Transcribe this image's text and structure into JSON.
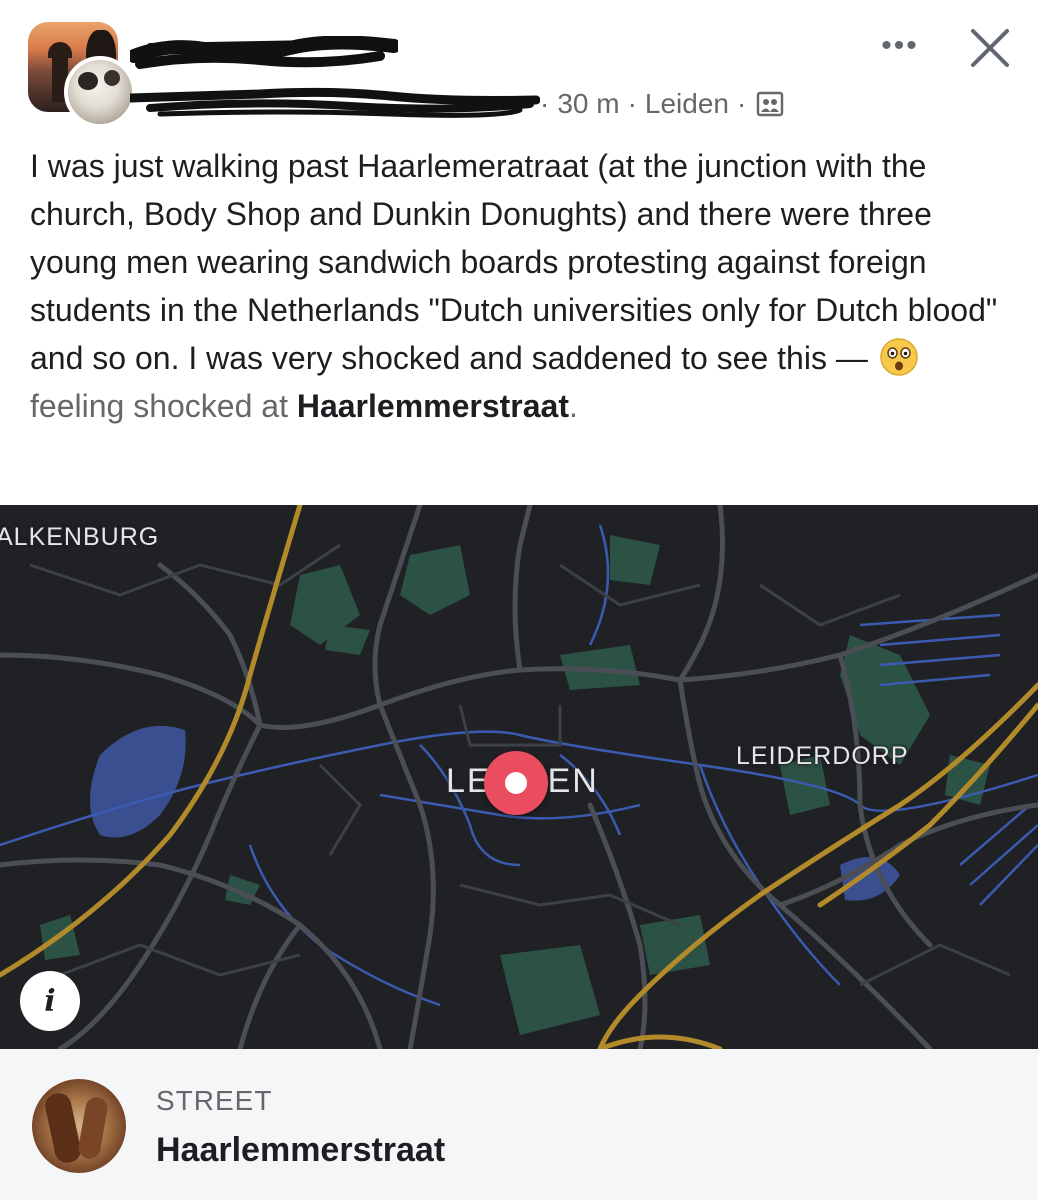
{
  "header": {
    "author_name": "",
    "shared_by": "",
    "time": "30 m",
    "location": "Leiden",
    "separator": "·",
    "privacy_icon": "public-globe-icon",
    "more_icon": "more-icon",
    "more_label": "•••",
    "close_icon": "close-icon"
  },
  "post": {
    "text": "I was just walking past Haarlemeratraat (at the junction with the church, Body Shop and Dunkin Donughts) and there were three young men wearing sandwich boards protesting against foreign students in the Netherlands \"Dutch universities only for Dutch blood\" and so on. I was very shocked and saddened to see this —",
    "emoji_icon": "shocked-face-emoji",
    "feeling_prefix": "feeling",
    "feeling_word": "shocked at",
    "place_link": "Haarlemmerstraat",
    "trailing": "."
  },
  "map": {
    "labels": {
      "west_town": "ALKENBURG",
      "east_town": "LEIDERDORP",
      "city_left": "LE",
      "city_right": "EN"
    },
    "pin_color": "#e94d5f",
    "info_label": "i",
    "colors": {
      "background": "#1f2125",
      "roads": "#4b4e55",
      "water": "#3a4f8f",
      "parks": "#2f5a4b",
      "highway": "#b38a2a"
    }
  },
  "place": {
    "kind": "STREET",
    "name": "Haarlemmerstraat"
  }
}
